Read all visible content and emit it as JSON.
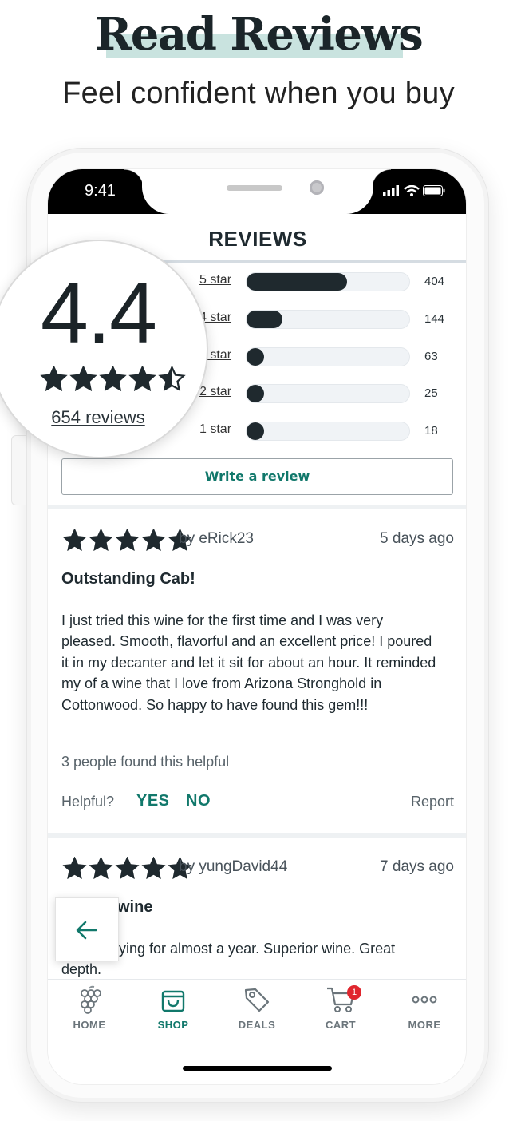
{
  "headline": {
    "title": "Read Reviews",
    "subtitle": "Feel confident when you buy"
  },
  "status_bar": {
    "time": "9:41"
  },
  "reviews_page": {
    "title": "REVIEWS",
    "summary": {
      "rating": "4.4",
      "stars": 4.5,
      "reviews_link": "654 reviews"
    },
    "histogram": [
      {
        "label": "5 star",
        "count": "404",
        "fraction": 0.62
      },
      {
        "label": "4 star",
        "count": "144",
        "fraction": 0.22
      },
      {
        "label": "3 star",
        "count": "63",
        "fraction": 0.1
      },
      {
        "label": "2 star",
        "count": "25",
        "fraction": 0.04
      },
      {
        "label": "1 star",
        "count": "18",
        "fraction": 0.03
      }
    ],
    "write_review_label": "Write a review"
  },
  "reviews": [
    {
      "stars": 5,
      "author": "by eRick23",
      "date": "5 days ago",
      "title": "Outstanding Cab!",
      "body": "I just tried this wine for the first time and I was very pleased. Smooth, flavorful and an excellent price! I poured it in my decanter and let it sit for about an hour. It reminded my of a wine that I love from Arizona Stronghold in Cottonwood. So happy to have found this gem!!!",
      "helpful_count": "3 people found this helpful",
      "helpful_label": "Helpful?",
      "yes_label": "YES",
      "no_label": "NO",
      "report_label": "Report"
    },
    {
      "stars": 5,
      "author": "by yungDavid44",
      "date": "7 days ago",
      "title": "wine",
      "body": "ying for almost a year. Superior wine. Great depth."
    }
  ],
  "tabbar": {
    "tabs": [
      {
        "label": "HOME",
        "icon": "grapes-icon"
      },
      {
        "label": "SHOP",
        "icon": "shopping-bag-icon",
        "active": true
      },
      {
        "label": "DEALS",
        "icon": "tag-icon"
      },
      {
        "label": "CART",
        "icon": "cart-icon",
        "badge": "1"
      },
      {
        "label": "MORE",
        "icon": "more-dots-icon"
      }
    ]
  },
  "back_button_icon": "arrow-left-icon",
  "colors": {
    "accent": "#11786b",
    "bar": "#1f292e",
    "badge": "#e0262e",
    "highlight": "#c9e3df"
  }
}
